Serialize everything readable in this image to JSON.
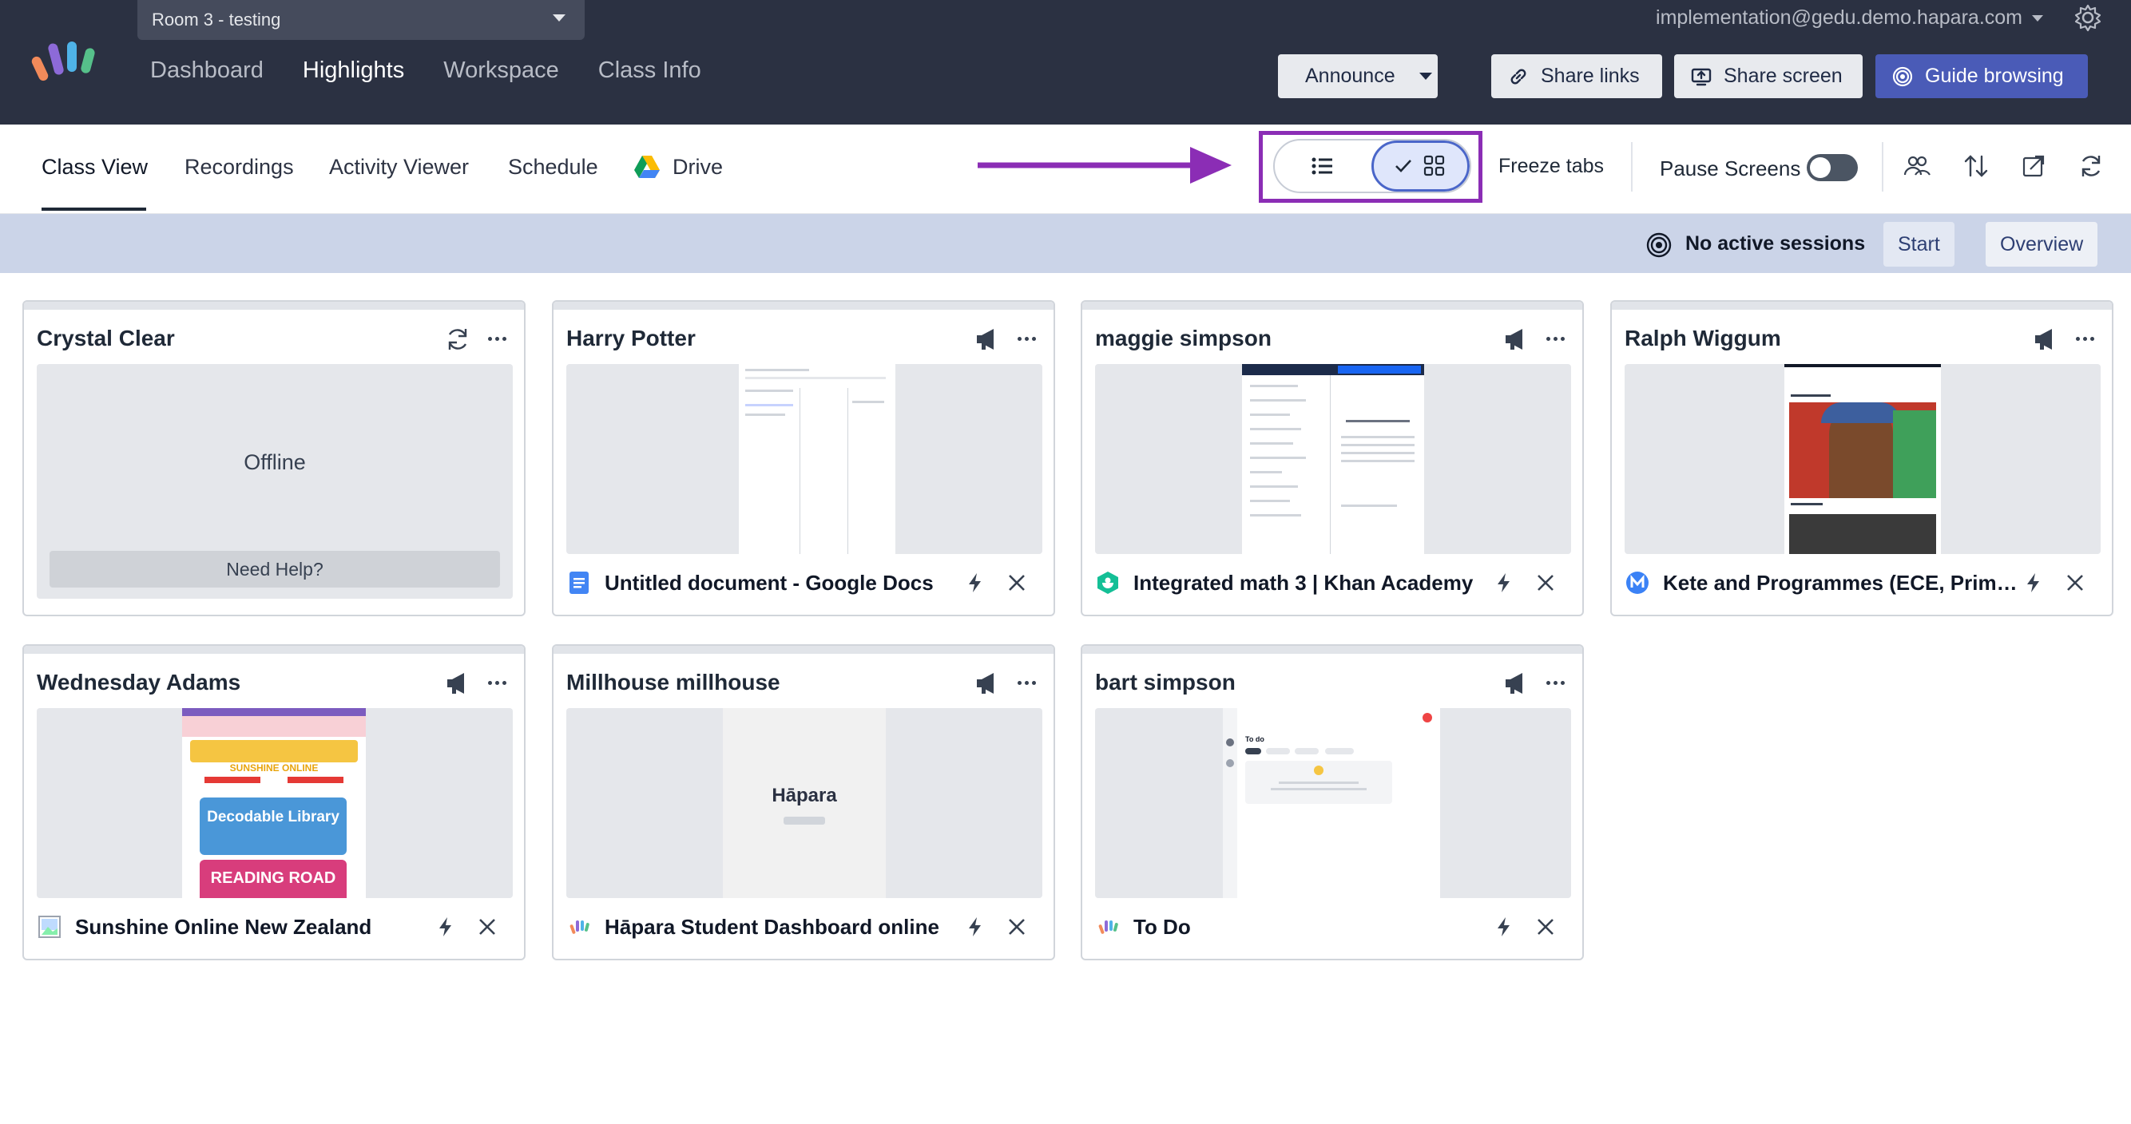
{
  "header": {
    "room": "Room 3 - testing",
    "account": "implementation@gedu.demo.hapara.com",
    "nav": [
      "Dashboard",
      "Highlights",
      "Workspace",
      "Class Info"
    ],
    "nav_active": "Highlights",
    "buttons": {
      "announce": "Announce",
      "share_links": "Share links",
      "share_screen": "Share screen",
      "guide_browsing": "Guide browsing"
    }
  },
  "subnav": {
    "tabs": [
      "Class View",
      "Recordings",
      "Activity Viewer",
      "Schedule",
      "Drive"
    ],
    "active_tab": "Class View",
    "view_mode": "grid",
    "freeze_tabs": "Freeze tabs",
    "pause_screens": "Pause Screens",
    "pause_screens_on": false
  },
  "session_bar": {
    "status": "No active sessions",
    "start": "Start",
    "overview": "Overview"
  },
  "students": [
    {
      "name": "Crystal Clear",
      "status": "Offline",
      "help": "Need Help?"
    },
    {
      "name": "Harry Potter",
      "tab_title": "Untitled document - Google Docs",
      "favicon": "google-docs-icon"
    },
    {
      "name": "maggie simpson",
      "tab_title": "Integrated math 3 | Khan Academy",
      "favicon": "khan-academy-icon"
    },
    {
      "name": "Ralph Wiggum",
      "tab_title": "Kete and Programmes (ECE, Primary...",
      "favicon": "kete-icon"
    },
    {
      "name": "Wednesday Adams",
      "tab_title": "Sunshine Online New Zealand",
      "favicon": "image-icon",
      "thumb_text": [
        "SUNSHINE ONLINE",
        "Decodable Library",
        "READING ROAD"
      ]
    },
    {
      "name": "Millhouse millhouse",
      "tab_title": "Hāpara Student Dashboard online",
      "favicon": "hapara-icon",
      "thumb_text": [
        "Hāpara"
      ]
    },
    {
      "name": "bart simpson",
      "tab_title": "To Do",
      "favicon": "hapara-icon",
      "thumb_text": [
        "To do"
      ]
    }
  ],
  "colors": {
    "topbar": "#2b3142",
    "accent": "#4a5bb7",
    "annotation": "#8b2db5",
    "session_bar": "#cbd4e8"
  }
}
